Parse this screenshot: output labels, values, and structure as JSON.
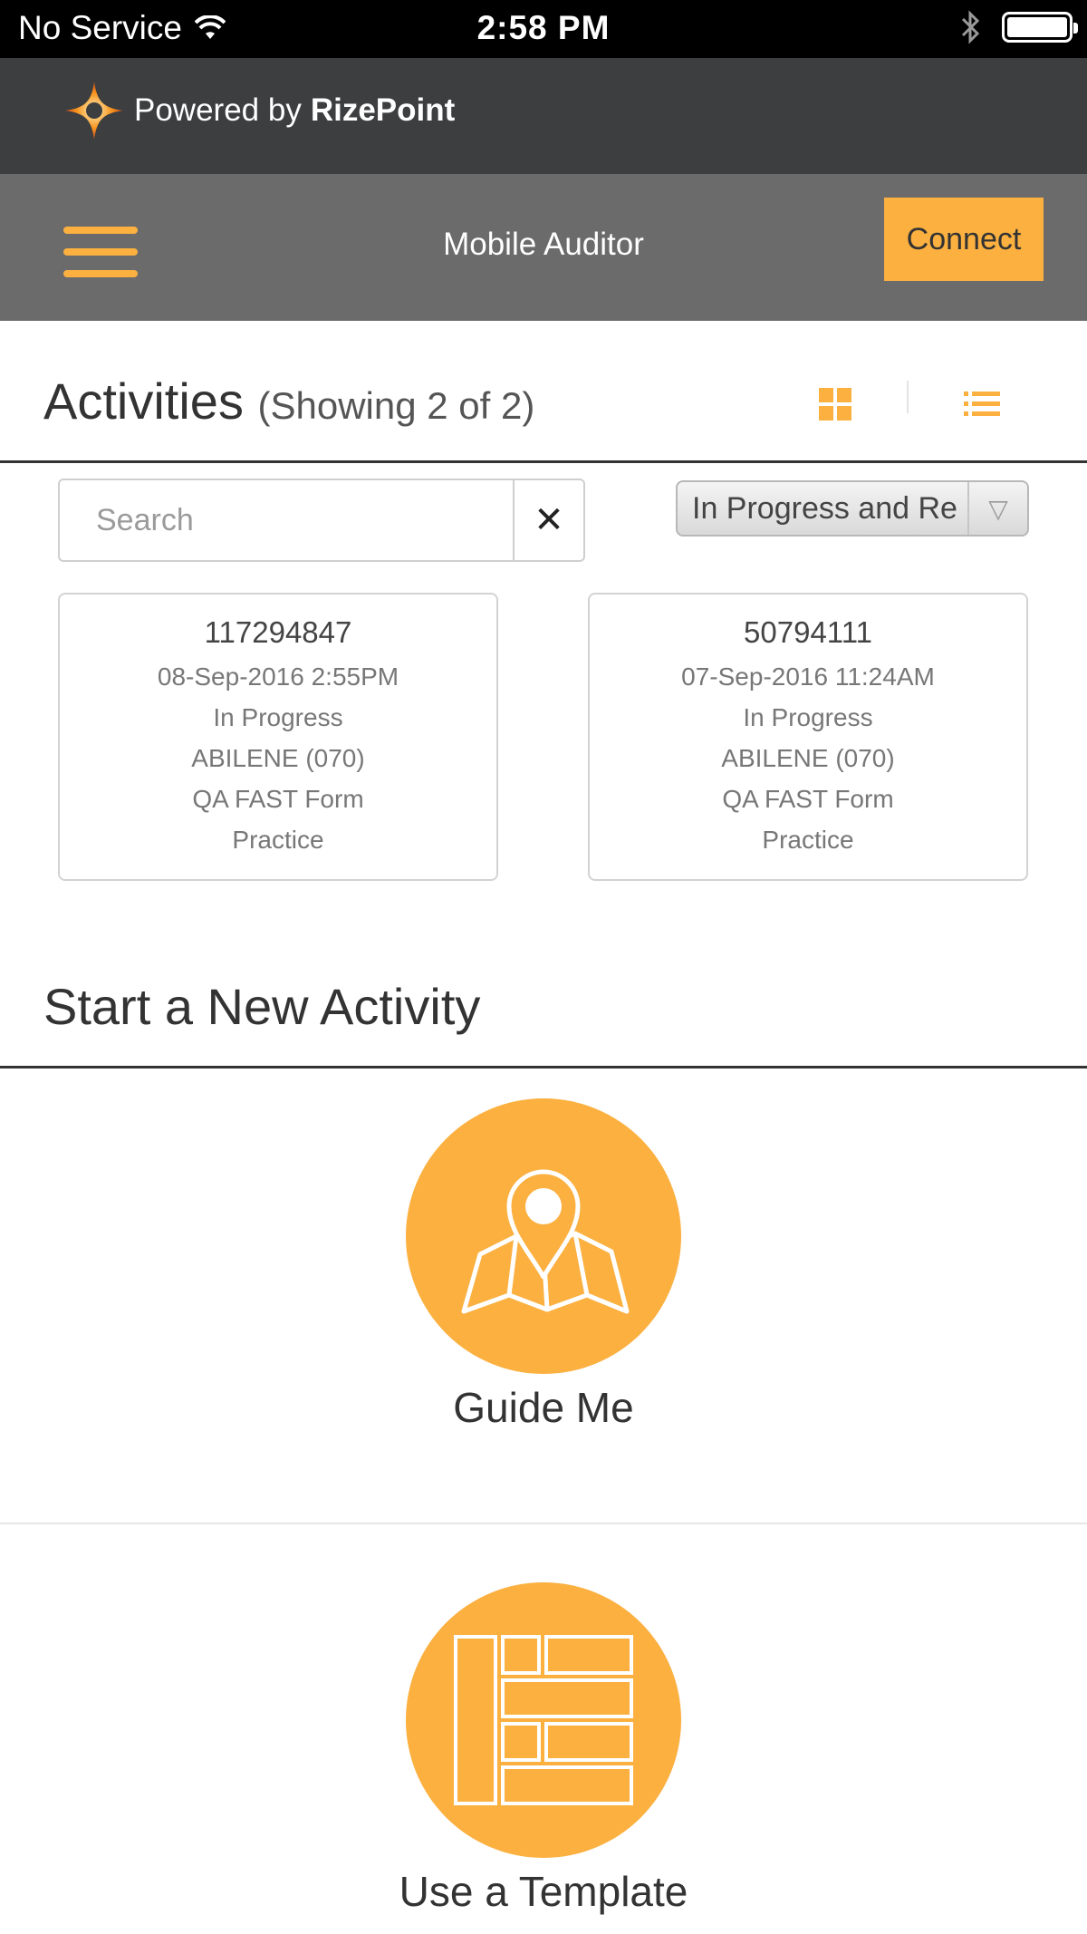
{
  "status_bar": {
    "carrier": "No Service",
    "time": "2:58 PM"
  },
  "brand": {
    "powered_by": "Powered by ",
    "name": "RizePoint"
  },
  "header": {
    "title": "Mobile Auditor",
    "connect_label": "Connect"
  },
  "activities": {
    "title": "Activities",
    "count": "(Showing 2 of 2)",
    "search_placeholder": "Search",
    "clear_label": "✕",
    "filter_value": "In Progress and Re",
    "items": [
      {
        "id": "117294847",
        "date": "08-Sep-2016 2:55PM",
        "status": "In Progress",
        "location": "ABILENE (070)",
        "form": "QA FAST Form",
        "type": "Practice"
      },
      {
        "id": "50794111",
        "date": "07-Sep-2016 11:24AM",
        "status": "In Progress",
        "location": "ABILENE (070)",
        "form": "QA FAST Form",
        "type": "Practice"
      }
    ]
  },
  "start_new": {
    "title": "Start a New Activity",
    "options": [
      {
        "label": "Guide Me",
        "icon": "map-pin-icon"
      },
      {
        "label": "Use a Template",
        "icon": "template-icon"
      }
    ]
  },
  "colors": {
    "accent": "#fbb040",
    "header_bg": "#6b6b6b",
    "brand_bg": "#3d3e40"
  }
}
